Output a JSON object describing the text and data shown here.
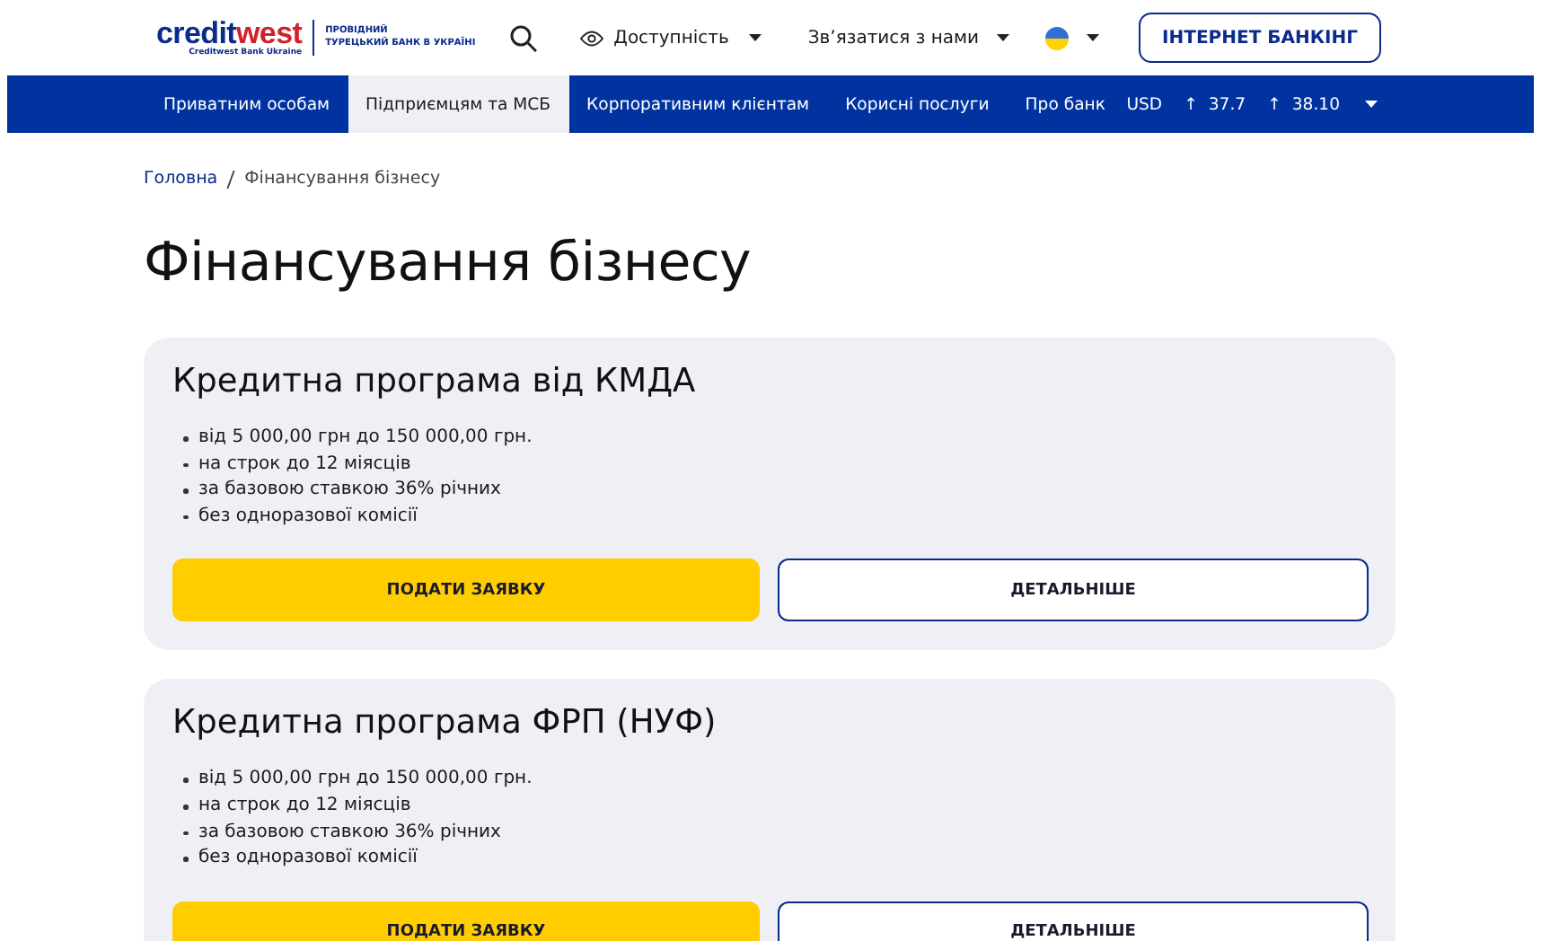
{
  "header": {
    "logo": "credit**west**",
    "logo_subtitle": "Creditwest Bank Ukraine",
    "tagline": [
      "ПРОВІДНИЙ",
      "ТУРЕЦЬКИЙ БАНК В УКРАЇНІ"
    ],
    "accessibility": "Доступність",
    "contact": "Зв’язатися з нами",
    "login_button": "ІНТЕРНЕТ БАНКІНГ"
  },
  "nav": {
    "items": [
      {
        "label": "Приватним особам",
        "selected": false
      },
      {
        "label": "Підприємцям та МСБ",
        "selected": true
      },
      {
        "label": "Корпоративним клієнтам",
        "selected": false
      },
      {
        "label": "Корисні послуги",
        "selected": false
      },
      {
        "label": "Про банк",
        "selected": false
      }
    ],
    "currency": {
      "code": "USD",
      "buy_arrow": "↑",
      "buy": "37.7",
      "sell_arrow": "↑",
      "sell": "38.10"
    }
  },
  "breadcrumbs": [
    {
      "label": "Головна",
      "kind": "link"
    },
    {
      "label": "Фінансування бізнесу",
      "kind": "current"
    }
  ],
  "title": "Фінансування бізнесу",
  "cards": [
    {
      "title": "Кредитна програма від КМДА",
      "features": [
        "від 5 000,00 грн до 150 000,00 грн.",
        "на строк до 12 міясців",
        "за базовою ставкою 36% річних",
        "без одноразової комісії"
      ],
      "apply_button": "ПОДАТИ ЗАЯВКУ",
      "details_button": "ДЕТАЛЬНІШЕ"
    },
    {
      "title": "Кредитна програма ФРП (НУФ)",
      "features": [
        "від 5 000,00 грн до 150 000,00 грн.",
        "на строк до 12 міясців",
        "за базовою ставкою 36% річних",
        "без одноразової комісії"
      ],
      "apply_button": "ПОДАТИ ЗАЯВКУ",
      "details_button": "ДЕТАЛЬНІШЕ"
    }
  ]
}
